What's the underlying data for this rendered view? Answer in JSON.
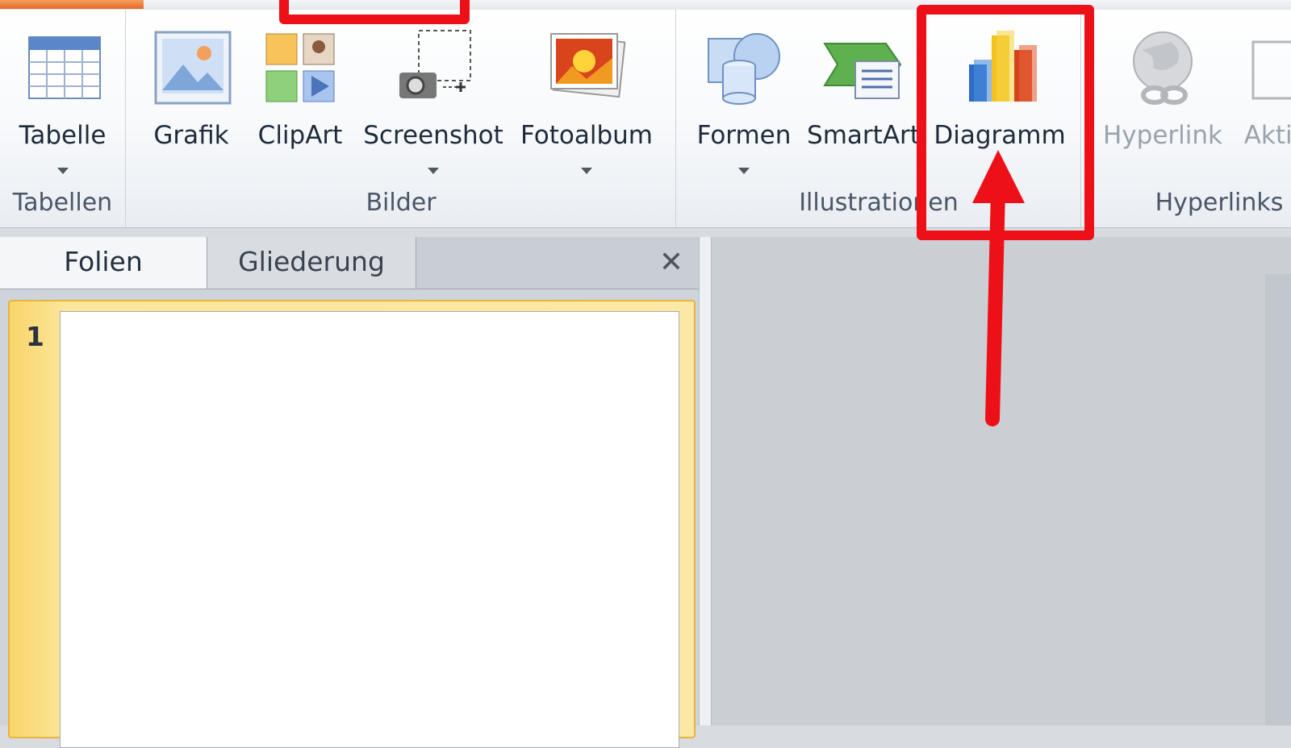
{
  "ribbon": {
    "groups": {
      "tabellen": {
        "label": "Tabellen",
        "buttons": {
          "tabelle": {
            "label": "Tabelle"
          }
        }
      },
      "bilder": {
        "label": "Bilder",
        "buttons": {
          "grafik": {
            "label": "Grafik"
          },
          "clipart": {
            "label": "ClipArt"
          },
          "screenshot": {
            "label": "Screenshot"
          },
          "fotoalbum": {
            "label": "Fotoalbum"
          }
        }
      },
      "illustrationen": {
        "label": "Illustrationen",
        "buttons": {
          "formen": {
            "label": "Formen"
          },
          "smartart": {
            "label": "SmartArt"
          },
          "diagramm": {
            "label": "Diagramm"
          }
        }
      },
      "hyperlinks": {
        "label": "Hyperlinks",
        "buttons": {
          "hyperlink": {
            "label": "Hyperlink"
          },
          "aktion": {
            "label": "Aktion"
          }
        }
      }
    }
  },
  "panel": {
    "tabs": {
      "folien": "Folien",
      "gliederung": "Gliederung"
    },
    "close_glyph": "✕",
    "slide_number": "1"
  },
  "annotation": {
    "color": "#ee1018",
    "highlighted_button": "Diagramm"
  },
  "icons": {
    "tabelle": "table-icon",
    "grafik": "picture-icon",
    "clipart": "clipart-icon",
    "screenshot": "screenshot-icon",
    "fotoalbum": "photo-album-icon",
    "formen": "shapes-icon",
    "smartart": "smartart-icon",
    "diagramm": "bar-chart-icon",
    "hyperlink": "globe-link-icon"
  }
}
